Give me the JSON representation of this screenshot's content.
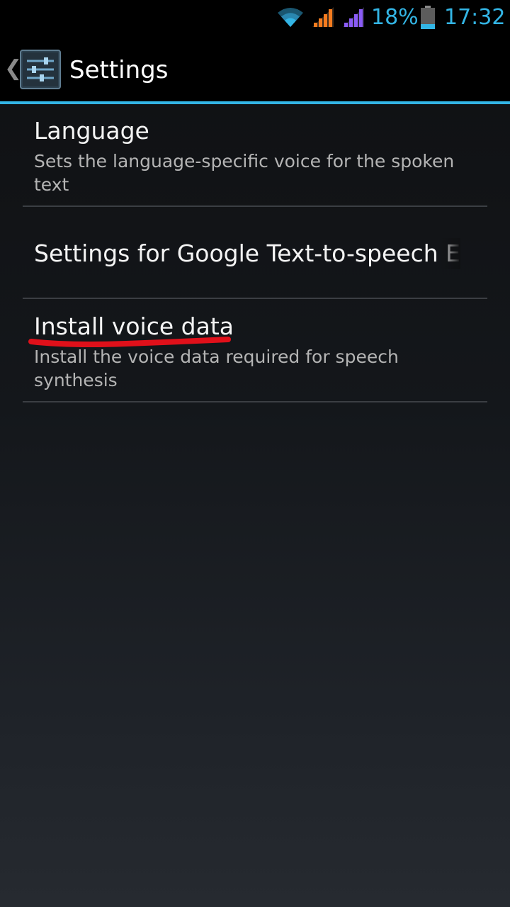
{
  "status_bar": {
    "battery_percent": "18%",
    "time": "17:32",
    "icons": [
      "wifi-icon",
      "signal-icon",
      "signal-icon",
      "battery-icon"
    ],
    "colors": {
      "accent": "#33b5e5",
      "signal1": "#f57c1f",
      "signal2": "#8b5cf6"
    }
  },
  "action_bar": {
    "title": "Settings",
    "icon": "settings-sliders-icon"
  },
  "preferences": [
    {
      "title": "Language",
      "summary": "Sets the language-specific voice for the spoken text"
    },
    {
      "title": "Settings for Google Text-to-speech Engine",
      "summary": ""
    },
    {
      "title": "Install voice data",
      "summary": "Install the voice data required for speech synthesis"
    }
  ],
  "annotation": {
    "color": "#e0101a"
  }
}
